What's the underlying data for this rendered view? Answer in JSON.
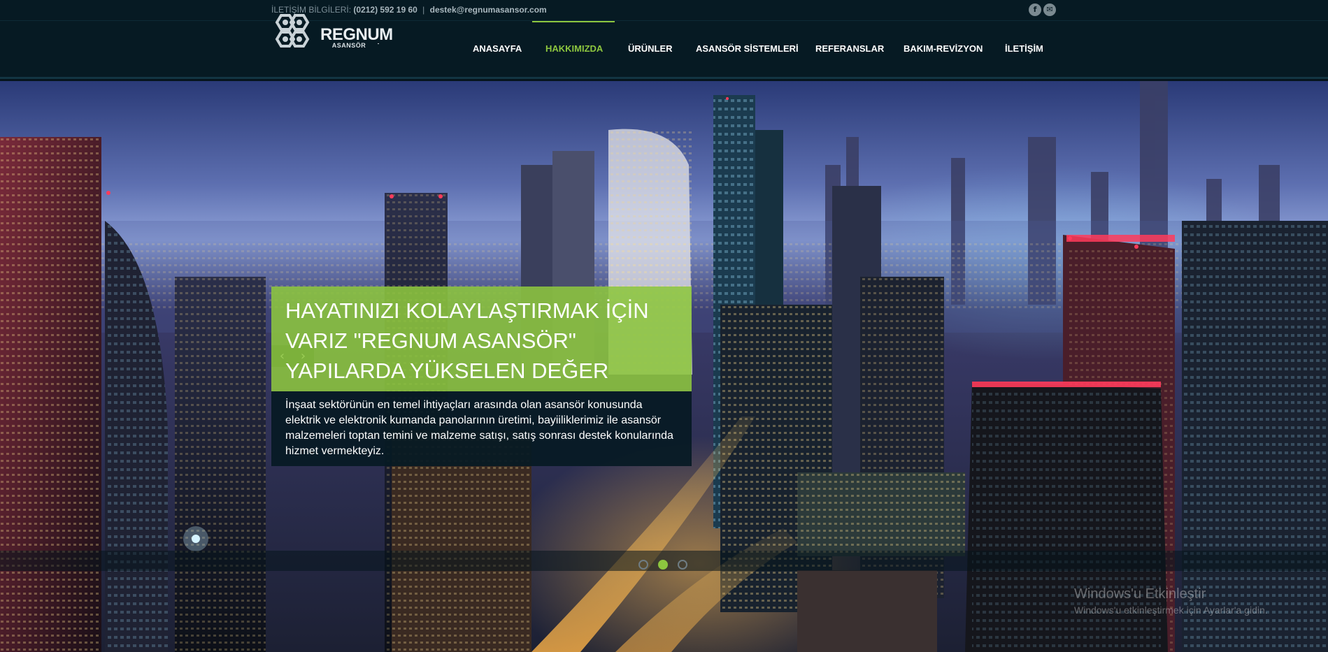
{
  "topbar": {
    "contact_label": "İLETİŞİM BİLGİLERİ:",
    "phone": "(0212) 592 19 60",
    "separator": "|",
    "email": "destek@regnumasansor.com",
    "social": [
      {
        "icon": "facebook-icon",
        "glyph": "f"
      },
      {
        "icon": "email-icon",
        "glyph": "✉"
      }
    ]
  },
  "brand": {
    "name": "REGNUM",
    "sub": "ASANSÖR"
  },
  "nav": {
    "items": [
      {
        "label": "ANASAYFA",
        "active": false
      },
      {
        "label": "HAKKIMIZDA",
        "active": true
      },
      {
        "label": "ÜRÜNLER",
        "active": false
      },
      {
        "label": "ASANSÖR SİSTEMLERİ",
        "active": false
      },
      {
        "label": "REFERANSLAR",
        "active": false
      },
      {
        "label": "BAKIM-REVİZYON",
        "active": false
      },
      {
        "label": "İLETİŞİM",
        "active": false
      }
    ],
    "active_color": "#8dc63f"
  },
  "hero": {
    "prev_icon": "‹",
    "next_icon": "›",
    "title_lines": [
      "HAYATINIZI KOLAYLAŞTIRMAK İÇİN",
      "VARIZ \"REGNUM ASANSÖR\"",
      "YAPILARDA YÜKSELEN DEĞER"
    ],
    "body": "İnşaat sektörünün en temel ihtiyaçları arasında olan asansör konusunda elektrik ve elektronik kumanda panolarının üretimi, bayiiliklerimiz ile asansör malzemeleri toptan temini ve malzeme satışı, satış sonrası destek konularında hizmet vermekteyiz.",
    "slides_count": 3,
    "active_slide": 2,
    "accent_color": "#8dc63f"
  },
  "os_watermark": {
    "line1": "Windows'u Etkinleştir",
    "line2": "Windows'u etkinleştirmek için Ayarlar'a gidin."
  }
}
